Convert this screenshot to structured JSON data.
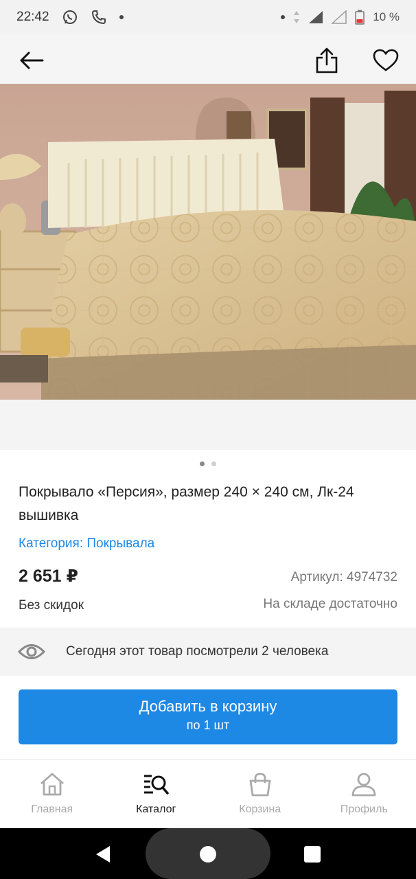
{
  "status_bar": {
    "time": "22:42",
    "battery": "10 %"
  },
  "product": {
    "title": "Покрывало «Персия», размер 240 × 240 см, Лк-24 вышивка",
    "category": "Категория: Покрывала",
    "price": "2 651 ₽",
    "sku": "Артикул: 4974732",
    "discount": "Без скидок",
    "stock": "На складе достаточно"
  },
  "views_text": "Сегодня этот товар посмотрели 2 человека",
  "add_to_cart": {
    "label": "Добавить в корзину",
    "sub": "по 1 шт"
  },
  "bottom_nav": [
    {
      "label": "Главная",
      "icon": "home-icon"
    },
    {
      "label": "Каталог",
      "icon": "catalog-search-icon"
    },
    {
      "label": "Корзина",
      "icon": "cart-bag-icon"
    },
    {
      "label": "Профиль",
      "icon": "profile-icon"
    }
  ],
  "colors": {
    "accent": "#1e88e5",
    "text": "#222222",
    "muted": "#777777"
  },
  "gallery": {
    "pages": 2,
    "active_page": 1
  }
}
